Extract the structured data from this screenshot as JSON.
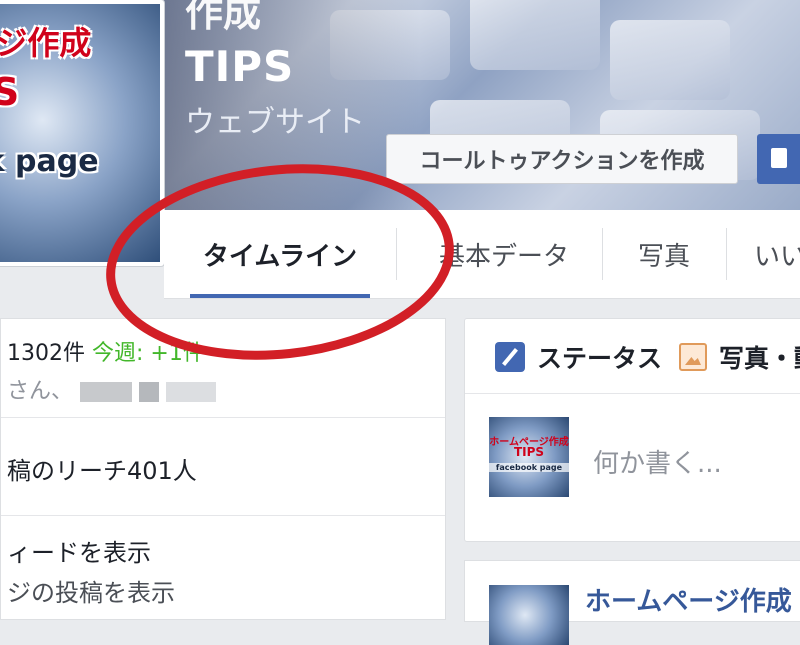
{
  "cover": {
    "title_top": "作成",
    "page_name": "TIPS",
    "category": "ウェブサイト",
    "cta_label": "コールトゥアクションを作成"
  },
  "profile_picture": {
    "line1": "ージ作成",
    "line2": "PS",
    "line3": "ok page"
  },
  "tabs": [
    {
      "label": "タイムライン",
      "active": true
    },
    {
      "label": "基本データ"
    },
    {
      "label": "写真"
    },
    {
      "label": "いい"
    }
  ],
  "left_column": {
    "likes_count": "1302件",
    "likes_week_label": "今週:",
    "likes_week_value": "+1件",
    "likes_names_suffix": "さん、",
    "reach": "稿のリーチ401人",
    "feed_link": "ィードを表示",
    "posts_link": "ジの投稿を表示"
  },
  "composer": {
    "tab_status": "ステータス",
    "tab_photo": "写真・動",
    "placeholder": "何か書く...",
    "avatar_line1": "ホームページ作成",
    "avatar_line2": "TIPS",
    "avatar_line3": "facebook page"
  },
  "post_card": {
    "title": "ホームページ作成"
  },
  "colors": {
    "accent": "#4267b2",
    "highlight_ellipse": "#d21f26",
    "green": "#42b72a"
  }
}
